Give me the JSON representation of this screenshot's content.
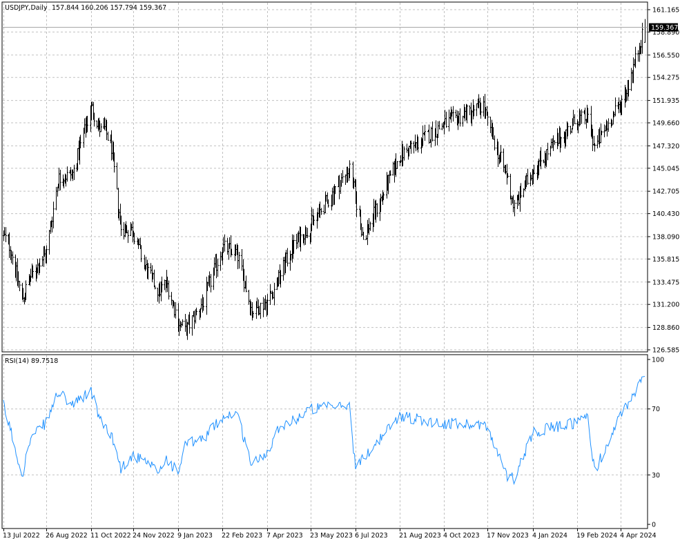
{
  "header": {
    "symbol": "USDJPY,Daily",
    "ohlc": "157.844 160.206 157.794 159.367"
  },
  "current_price_label": "159.367",
  "rsi_header": "RSI(14) 89.7518",
  "colors": {
    "background": "#ffffff",
    "bars": "#000000",
    "rsi_line": "#1e90ff",
    "grid": "#c0c0c0",
    "price_tag_bg": "#000000",
    "price_tag_fg": "#ffffff"
  },
  "chart_data": [
    {
      "type": "ohlc",
      "title": "USDJPY,Daily",
      "y_ticks": [
        "161.165",
        "158.890",
        "156.550",
        "154.275",
        "151.935",
        "149.660",
        "147.320",
        "145.045",
        "142.705",
        "140.430",
        "138.090",
        "135.815",
        "133.475",
        "131.200",
        "128.860",
        "126.585"
      ],
      "ylim": [
        126.585,
        161.165
      ],
      "current_price": 159.367,
      "x_ticks": [
        "13 Jul 2022",
        "26 Aug 2022",
        "11 Oct 2022",
        "24 Nov 2022",
        "9 Jan 2023",
        "22 Feb 2023",
        "7 Apr 2023",
        "23 May 2023",
        "6 Jul 2023",
        "21 Aug 2023",
        "4 Oct 2023",
        "17 Nov 2023",
        "4 Jan 2024",
        "19 Feb 2024",
        "4 Apr 2024"
      ],
      "grid": true,
      "series_keypoints": {
        "x": [
          "13 Jul 2022",
          "20 Jul 2022",
          "1 Aug 2022",
          "10 Aug 2022",
          "26 Aug 2022",
          "7 Sep 2022",
          "22 Sep 2022",
          "11 Oct 2022",
          "21 Oct 2022",
          "25 Oct 2022",
          "1 Nov 2022",
          "11 Nov 2022",
          "24 Nov 2022",
          "5 Dec 2022",
          "20 Dec 2022",
          "28 Dec 2022",
          "9 Jan 2023",
          "16 Jan 2023",
          "3 Feb 2023",
          "22 Feb 2023",
          "8 Mar 2023",
          "23 Mar 2023",
          "7 Apr 2023",
          "20 Apr 2023",
          "2 May 2023",
          "23 May 2023",
          "30 Jun 2023",
          "6 Jul 2023",
          "14 Jul 2023",
          "21 Aug 2023",
          "4 Oct 2023",
          "13 Nov 2023",
          "17 Nov 2023",
          "7 Dec 2023",
          "15 Dec 2023",
          "4 Jan 2024",
          "19 Feb 2024",
          "1 Mar 2024",
          "8 Mar 2024",
          "4 Apr 2024",
          "10 Apr 2024",
          "29 Apr 2024"
        ],
        "close": [
          138.2,
          137.0,
          131.7,
          134.0,
          136.5,
          144.0,
          144.5,
          151.3,
          148.8,
          149.0,
          147.2,
          139.0,
          138.7,
          135.2,
          132.5,
          133.5,
          129.5,
          128.5,
          131.5,
          137.0,
          136.5,
          130.5,
          131.5,
          134.0,
          136.8,
          139.3,
          145.0,
          142.0,
          137.9,
          146.3,
          149.5,
          151.5,
          149.6,
          144.3,
          141.0,
          145.0,
          150.0,
          150.2,
          147.2,
          151.7,
          153.0,
          159.4
        ]
      }
    },
    {
      "type": "line",
      "title": "RSI(14) 89.7518",
      "y_ticks": [
        "100",
        "70",
        "30",
        "0"
      ],
      "ylim": [
        0,
        100
      ],
      "grid": true,
      "series_keypoints": {
        "x": [
          "13 Jul 2022",
          "20 Jul 2022",
          "1 Aug 2022",
          "10 Aug 2022",
          "26 Aug 2022",
          "7 Sep 2022",
          "22 Sep 2022",
          "11 Oct 2022",
          "21 Oct 2022",
          "25 Oct 2022",
          "1 Nov 2022",
          "11 Nov 2022",
          "24 Nov 2022",
          "5 Dec 2022",
          "20 Dec 2022",
          "28 Dec 2022",
          "9 Jan 2023",
          "16 Jan 2023",
          "3 Feb 2023",
          "22 Feb 2023",
          "8 Mar 2023",
          "23 Mar 2023",
          "7 Apr 2023",
          "20 Apr 2023",
          "2 May 2023",
          "23 May 2023",
          "30 Jun 2023",
          "6 Jul 2023",
          "14 Jul 2023",
          "21 Aug 2023",
          "4 Oct 2023",
          "13 Nov 2023",
          "17 Nov 2023",
          "7 Dec 2023",
          "15 Dec 2023",
          "4 Jan 2024",
          "19 Feb 2024",
          "1 Mar 2024",
          "8 Mar 2024",
          "4 Apr 2024",
          "10 Apr 2024",
          "29 Apr 2024"
        ],
        "values": [
          72,
          58,
          30,
          52,
          62,
          80,
          72,
          81,
          62,
          60,
          55,
          34,
          42,
          38,
          32,
          40,
          31,
          48,
          52,
          65,
          68,
          36,
          44,
          60,
          62,
          70,
          72,
          34,
          40,
          66,
          61,
          61,
          58,
          30,
          28,
          56,
          62,
          66,
          32,
          66,
          72,
          90
        ]
      }
    }
  ]
}
